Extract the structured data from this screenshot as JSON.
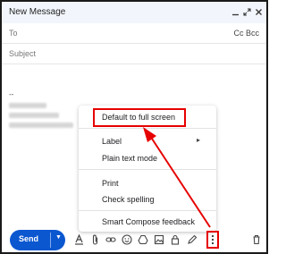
{
  "window": {
    "title": "New Message"
  },
  "fields": {
    "to_label": "To",
    "cc_bcc": "Cc Bcc",
    "subject_placeholder": "Subject"
  },
  "signature": {
    "dash": "--"
  },
  "menu": {
    "items": [
      {
        "label": "Default to full screen"
      },
      {
        "label": "Label",
        "submenu": true
      },
      {
        "label": "Plain text mode"
      },
      {
        "label": "Print"
      },
      {
        "label": "Check spelling"
      },
      {
        "label": "Smart Compose feedback"
      }
    ]
  },
  "toolbar": {
    "send_label": "Send",
    "icons": [
      "format-text-icon",
      "attach-icon",
      "link-icon",
      "emoji-icon",
      "drive-icon",
      "photo-icon",
      "lock-icon",
      "pen-icon",
      "more-options-icon",
      "trash-icon"
    ]
  },
  "colors": {
    "accent": "#0b57d0",
    "annotation": "#e60000",
    "titlebar_bg": "#f2f6fc"
  }
}
